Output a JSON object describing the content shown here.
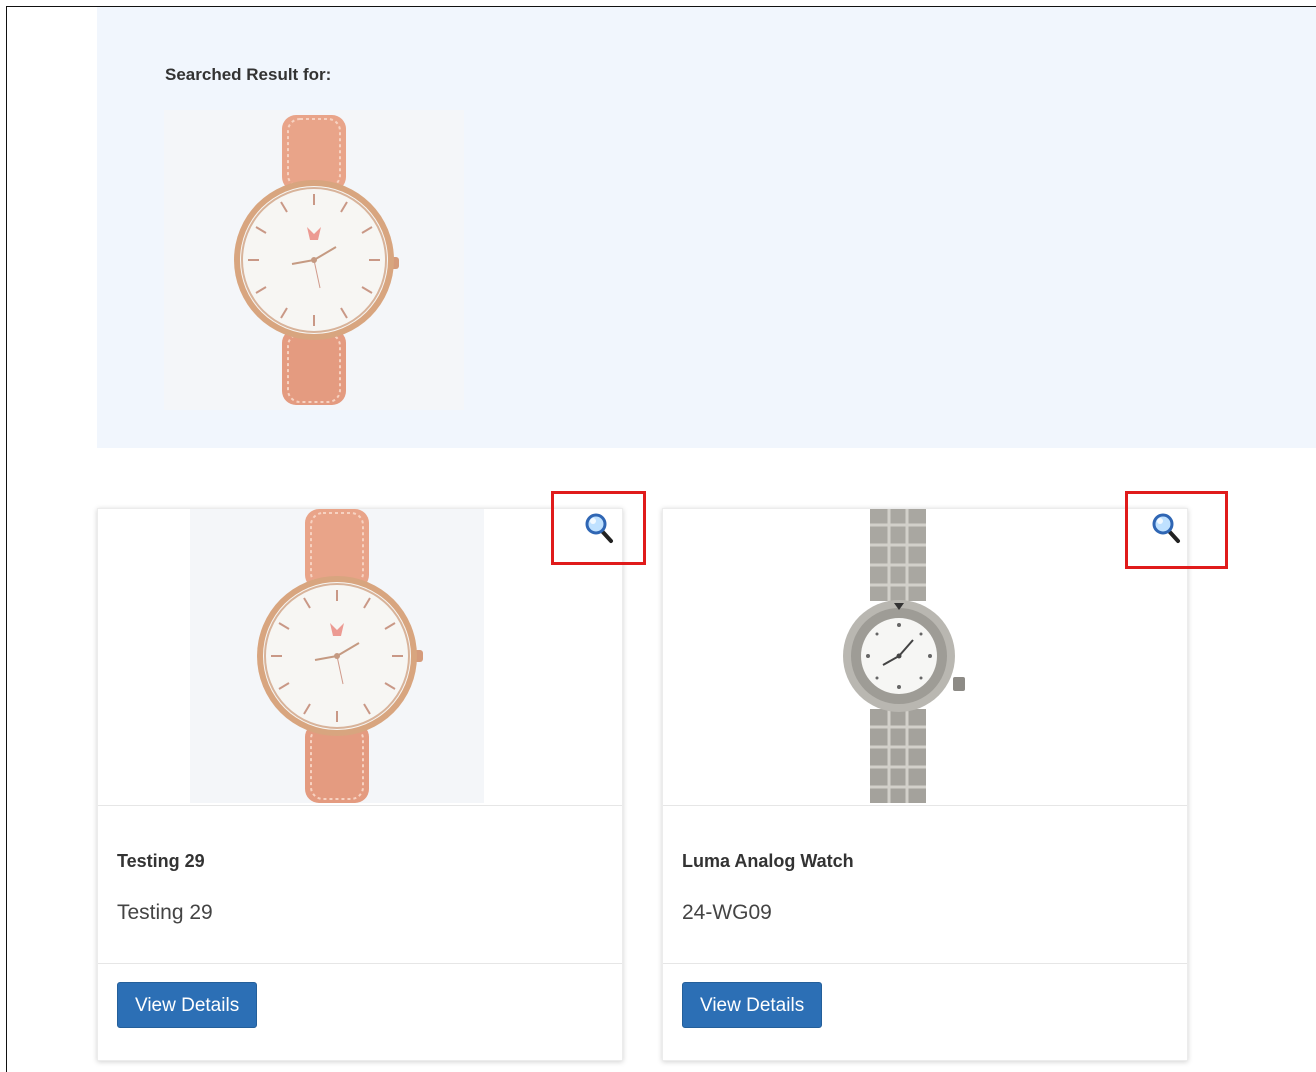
{
  "search": {
    "heading": "Searched Result for:",
    "query_image_alt": "rose gold watch with peach leather strap"
  },
  "products": [
    {
      "name": "Testing 29",
      "sku": "Testing 29",
      "button_label": "View Details",
      "image_alt": "rose gold watch with peach leather strap",
      "zoom_icon": "magnifier-icon"
    },
    {
      "name": "Luma Analog Watch",
      "sku": "24-WG09",
      "button_label": "View Details",
      "image_alt": "stainless steel dive watch",
      "zoom_icon": "magnifier-icon"
    }
  ],
  "colors": {
    "panel_bg": "#f1f6fd",
    "button_bg": "#2c6fb5",
    "highlight": "#e01b1b"
  }
}
